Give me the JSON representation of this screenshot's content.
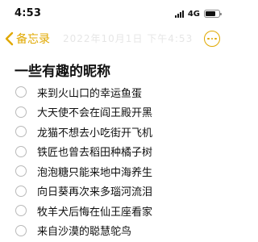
{
  "status_bar": {
    "time": "4:53",
    "network": "4G"
  },
  "nav": {
    "back_label": "备忘录",
    "faded_header": "2022年10月1日 下午4:53"
  },
  "note": {
    "title": "一些有趣的昵称",
    "items": [
      "来到火山口的幸运鱼蛋",
      "大天使不会在阎王殿开黑",
      "龙猫不想去小吃街开飞机",
      "铁匠也曾去稻田种橘子树",
      "泡泡糖只能来地中海养生",
      "向日葵再次来多瑙河流泪",
      "牧羊犬后悔在仙王座看家",
      "来自沙漠的聪慧鸵鸟"
    ]
  },
  "colors": {
    "accent": "#e0a800",
    "text": "#111111",
    "checkbox_border": "#b9b9b9"
  },
  "icons": {
    "back": "chevron-left-icon",
    "more": "ellipsis-circle-icon",
    "signal": "signal-bars-icon",
    "battery": "battery-icon"
  },
  "battery_level": 0.75
}
